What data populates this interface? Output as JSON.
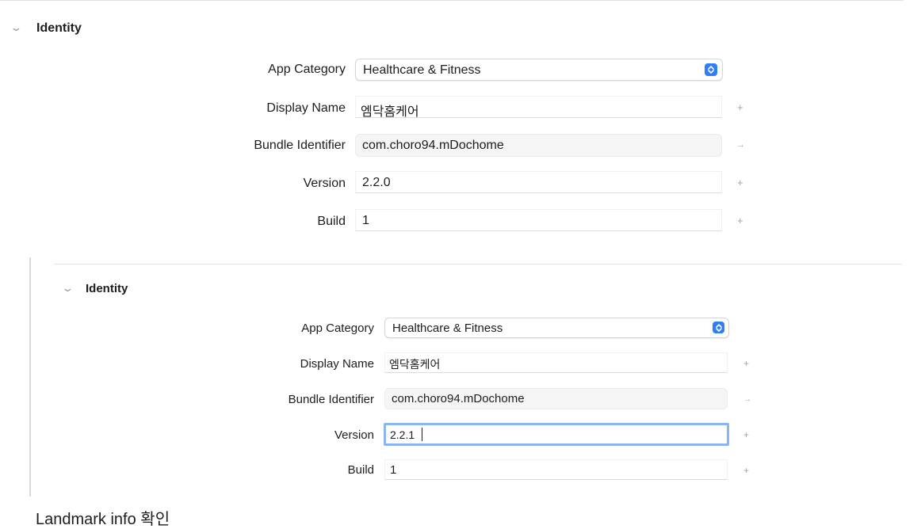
{
  "panel_top": {
    "section_title": "Identity",
    "app_category_label": "App Category",
    "app_category_value": "Healthcare & Fitness",
    "display_name_label": "Display Name",
    "display_name_value": "엠닥홈케어",
    "bundle_id_label": "Bundle Identifier",
    "bundle_id_value": "com.choro94.mDochome",
    "version_label": "Version",
    "version_value": "2.2.0",
    "build_label": "Build",
    "build_value": "1",
    "plus_mark": "+",
    "arrow_mark": "→"
  },
  "panel_bottom": {
    "section_title": "Identity",
    "app_category_label": "App Category",
    "app_category_value": "Healthcare & Fitness",
    "display_name_label": "Display Name",
    "display_name_value": "엠닥홈케어",
    "bundle_id_label": "Bundle Identifier",
    "bundle_id_value": "com.choro94.mDochome",
    "version_label": "Version",
    "version_value": "2.2.1",
    "build_label": "Build",
    "build_value": "1",
    "plus_mark": "+",
    "arrow_mark": "→"
  },
  "footer_text": "Landmark info 확인"
}
